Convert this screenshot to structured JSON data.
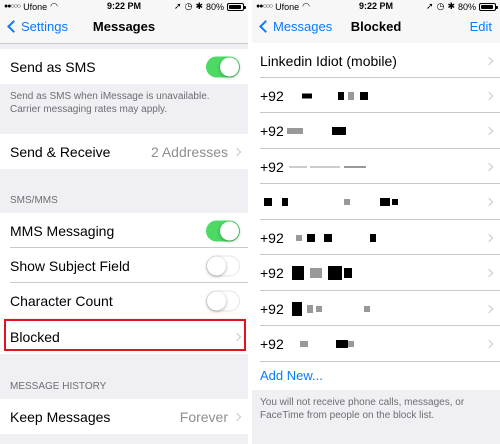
{
  "left": {
    "status": {
      "carrier": "Ufone",
      "time": "9:22 PM",
      "battery": "80%",
      "battery_level": 0.8
    },
    "nav": {
      "back_label": "Settings",
      "title": "Messages"
    },
    "send_as_sms": {
      "label": "Send as SMS",
      "toggle": "on"
    },
    "sms_footnote": "Send as SMS when iMessage is unavailable. Carrier messaging rates may apply.",
    "send_receive": {
      "label": "Send & Receive",
      "value": "2 Addresses"
    },
    "sms_mms_header": "SMS/MMS",
    "mms_messaging": {
      "label": "MMS Messaging",
      "toggle": "on"
    },
    "show_subject": {
      "label": "Show Subject Field",
      "toggle": "off"
    },
    "character_count": {
      "label": "Character Count",
      "toggle": "off"
    },
    "blocked": {
      "label": "Blocked"
    },
    "history_header": "MESSAGE HISTORY",
    "keep_messages": {
      "label": "Keep Messages",
      "value": "Forever"
    }
  },
  "right": {
    "status": {
      "carrier": "Ufone",
      "time": "9:22 PM",
      "battery": "80%",
      "battery_level": 0.8
    },
    "nav": {
      "back_label": "Messages",
      "title": "Blocked",
      "edit_label": "Edit"
    },
    "contact": "Linkedin Idiot  (mobile)",
    "blocked_numbers": [
      "+92",
      "+92",
      "+92",
      "",
      "+92",
      "+92",
      "+92",
      "+92"
    ],
    "add_new": "Add New...",
    "footnote": "You will not receive phone calls, messages, or FaceTime from people on the block list."
  },
  "colors": {
    "accent": "#0a7aff",
    "toggle_on": "#4cd964",
    "highlight": "#e0141e"
  },
  "icons": [
    "signal-dots-icon",
    "wifi-icon",
    "location-icon",
    "alarm-icon",
    "bluetooth-icon",
    "battery-icon",
    "back-chevron-icon",
    "disclosure-chevron-icon"
  ]
}
